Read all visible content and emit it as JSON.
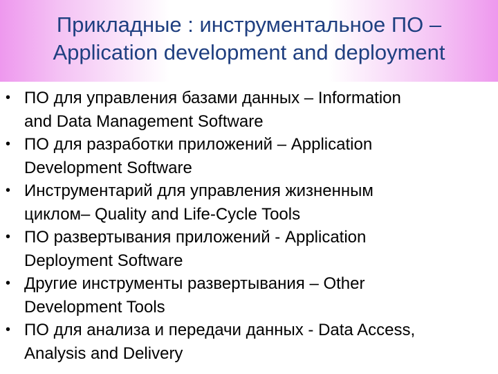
{
  "slide": {
    "title_lines": [
      "Прикладные : инструментальное ПО –",
      "Application development and deployment"
    ],
    "bullet_marker": "•",
    "bullets": [
      {
        "lines": [
          "ПО для управления базами данных – Information",
          "and Data Management Software"
        ]
      },
      {
        "lines": [
          "ПО для разработки приложений – Application",
          "Development Software"
        ]
      },
      {
        "lines": [
          "Инструментарий для управления жизненным",
          "циклом– Quality and Life-Cycle  Tools"
        ]
      },
      {
        "lines": [
          "ПО развертывания приложений - Application",
          "Deployment Software"
        ]
      },
      {
        "lines": [
          "Другие инструменты развертывания – Other",
          "Development Tools"
        ]
      },
      {
        "lines": [
          "ПО для анализа и передачи данных - Data Access,",
          "Analysis and Delivery"
        ]
      }
    ],
    "colors": {
      "title_text": "#1f3f80",
      "title_band_edge": "#ee98ee",
      "body_text": "#000000",
      "background": "#ffffff"
    }
  }
}
